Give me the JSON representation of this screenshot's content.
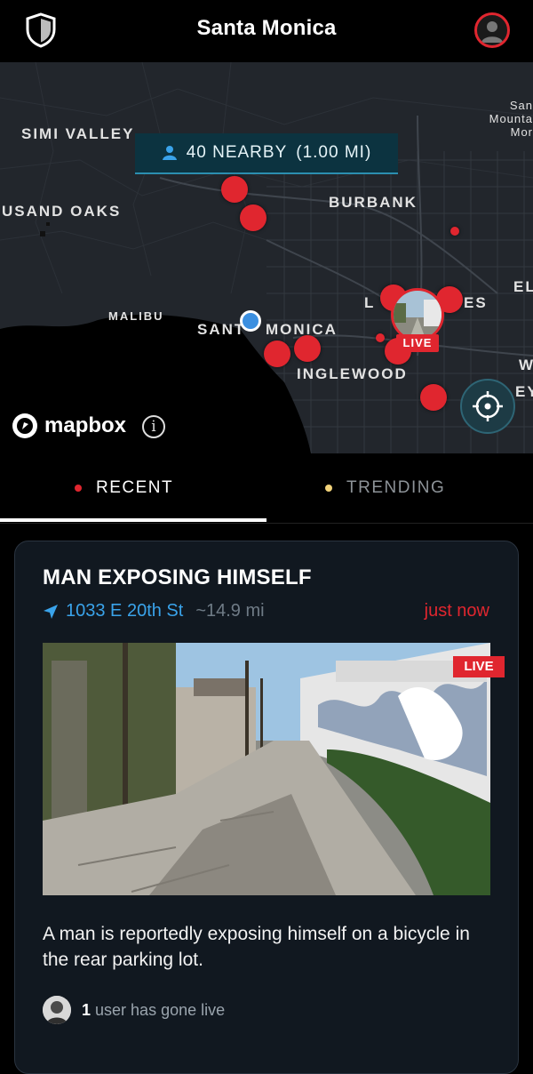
{
  "header": {
    "title": "Santa Monica",
    "shield_icon": "shield-icon",
    "profile_icon": "user-avatar-icon",
    "accent": "#e0262f"
  },
  "map": {
    "nearby": {
      "count": "40 NEARBY",
      "radius": "(1.00 MI)",
      "icon": "person-icon"
    },
    "labels": {
      "simi_valley": "SIMI VALLEY",
      "thousand_oaks": "USAND OAKS",
      "burbank": "BURBANK",
      "malibu": "MALIBU",
      "santa_monica_a": "SANT",
      "santa_monica_b": "MONICA",
      "inglewood": "INGLEWOOD",
      "los_angeles_a": "L",
      "los_angeles_b": "ES",
      "el": "EL",
      "w": "W",
      "ey": "EY",
      "san_gabriel_1": "San",
      "san_gabriel_2": "Mounta",
      "san_gabriel_3": "Mor"
    },
    "live_badge": "LIVE",
    "attribution": "mapbox",
    "info_symbol": "i",
    "locate_icon": "crosshair-icon"
  },
  "tabs": [
    {
      "label": "RECENT",
      "active": true,
      "color": "#e0262f"
    },
    {
      "label": "TRENDING",
      "active": false,
      "color": "#f2d37a"
    }
  ],
  "incident": {
    "title": "MAN EXPOSING HIMSELF",
    "address": "1033 E 20th St",
    "distance": "~14.9 mi",
    "time": "just now",
    "live_badge": "LIVE",
    "description": "A man is reportedly exposing himself on a bicycle in the rear parking lot.",
    "live_count": "1",
    "live_text": "user has gone live",
    "nav_icon": "navigation-arrow-icon"
  }
}
